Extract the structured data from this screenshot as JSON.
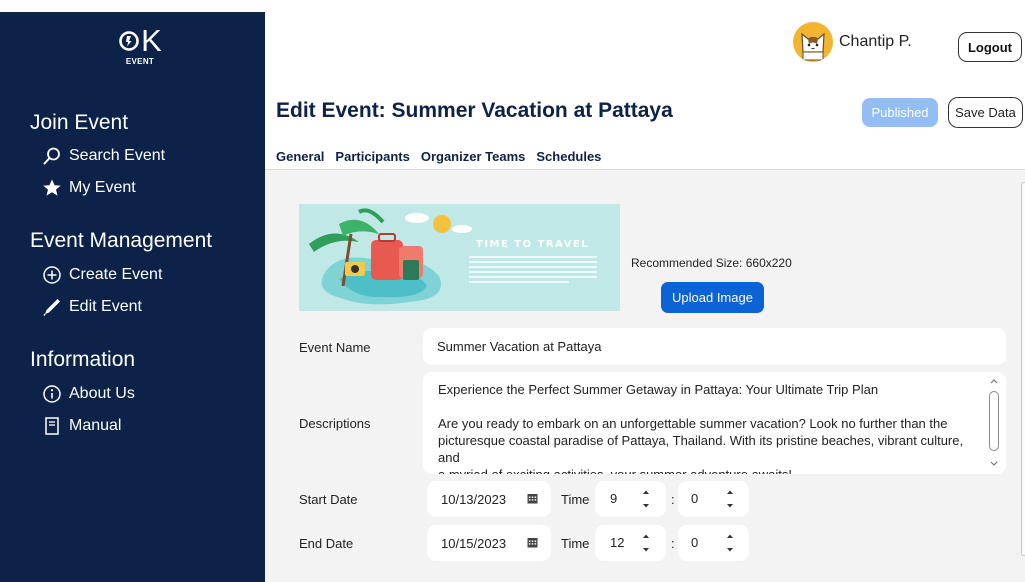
{
  "brand": {
    "logo_text": "K",
    "logo_sub": "EVENT"
  },
  "sidebar": {
    "sections": [
      {
        "title": "Join Event",
        "items": [
          {
            "label": "Search Event",
            "icon": "search-icon"
          },
          {
            "label": "My Event",
            "icon": "star-icon"
          }
        ]
      },
      {
        "title": "Event Management",
        "items": [
          {
            "label": "Create Event",
            "icon": "plus-circle-icon"
          },
          {
            "label": "Edit Event",
            "icon": "pencil-icon"
          }
        ]
      },
      {
        "title": "Information",
        "items": [
          {
            "label": "About Us",
            "icon": "info-circle-icon"
          },
          {
            "label": "Manual",
            "icon": "document-icon"
          }
        ]
      }
    ]
  },
  "header": {
    "user_name": "Chantip P.",
    "logout_label": "Logout"
  },
  "page": {
    "title": "Edit Event: Summer Vacation at Pattaya",
    "published_label": "Published",
    "save_label": "Save Data"
  },
  "tabs": [
    {
      "label": "General"
    },
    {
      "label": "Participants"
    },
    {
      "label": "Organizer Teams"
    },
    {
      "label": "Schedules"
    }
  ],
  "image_section": {
    "banner_text": "TIME TO TRAVEL",
    "recommended": "Recommended Size: 660x220",
    "upload_label": "Upload Image"
  },
  "form": {
    "event_name_label": "Event Name",
    "event_name_value": "Summer Vacation at Pattaya",
    "descriptions_label": "Descriptions",
    "description_lines": [
      "Experience the Perfect Summer Getaway in Pattaya: Your Ultimate Trip Plan",
      "Are you ready to embark on an unforgettable summer vacation? Look no further than the",
      "picturesque coastal paradise of Pattaya, Thailand. With its pristine beaches, vibrant culture, and",
      "a myriad of exciting activities, your summer adventure awaits!"
    ],
    "start_date_label": "Start Date",
    "start_date_value": "10/13/2023",
    "start_hour": "9",
    "start_minute": "0",
    "end_date_label": "End Date",
    "end_date_value": "10/15/2023",
    "end_hour": "12",
    "end_minute": "0",
    "time_label": "Time",
    "colon": ":"
  },
  "colors": {
    "sidebar_bg": "#0c2248",
    "title": "#0c2248",
    "upload_button": "#0b63d6",
    "published_button": "#93bef5",
    "content_bg": "#f3f3f3",
    "avatar_bg": "#f2b531"
  }
}
